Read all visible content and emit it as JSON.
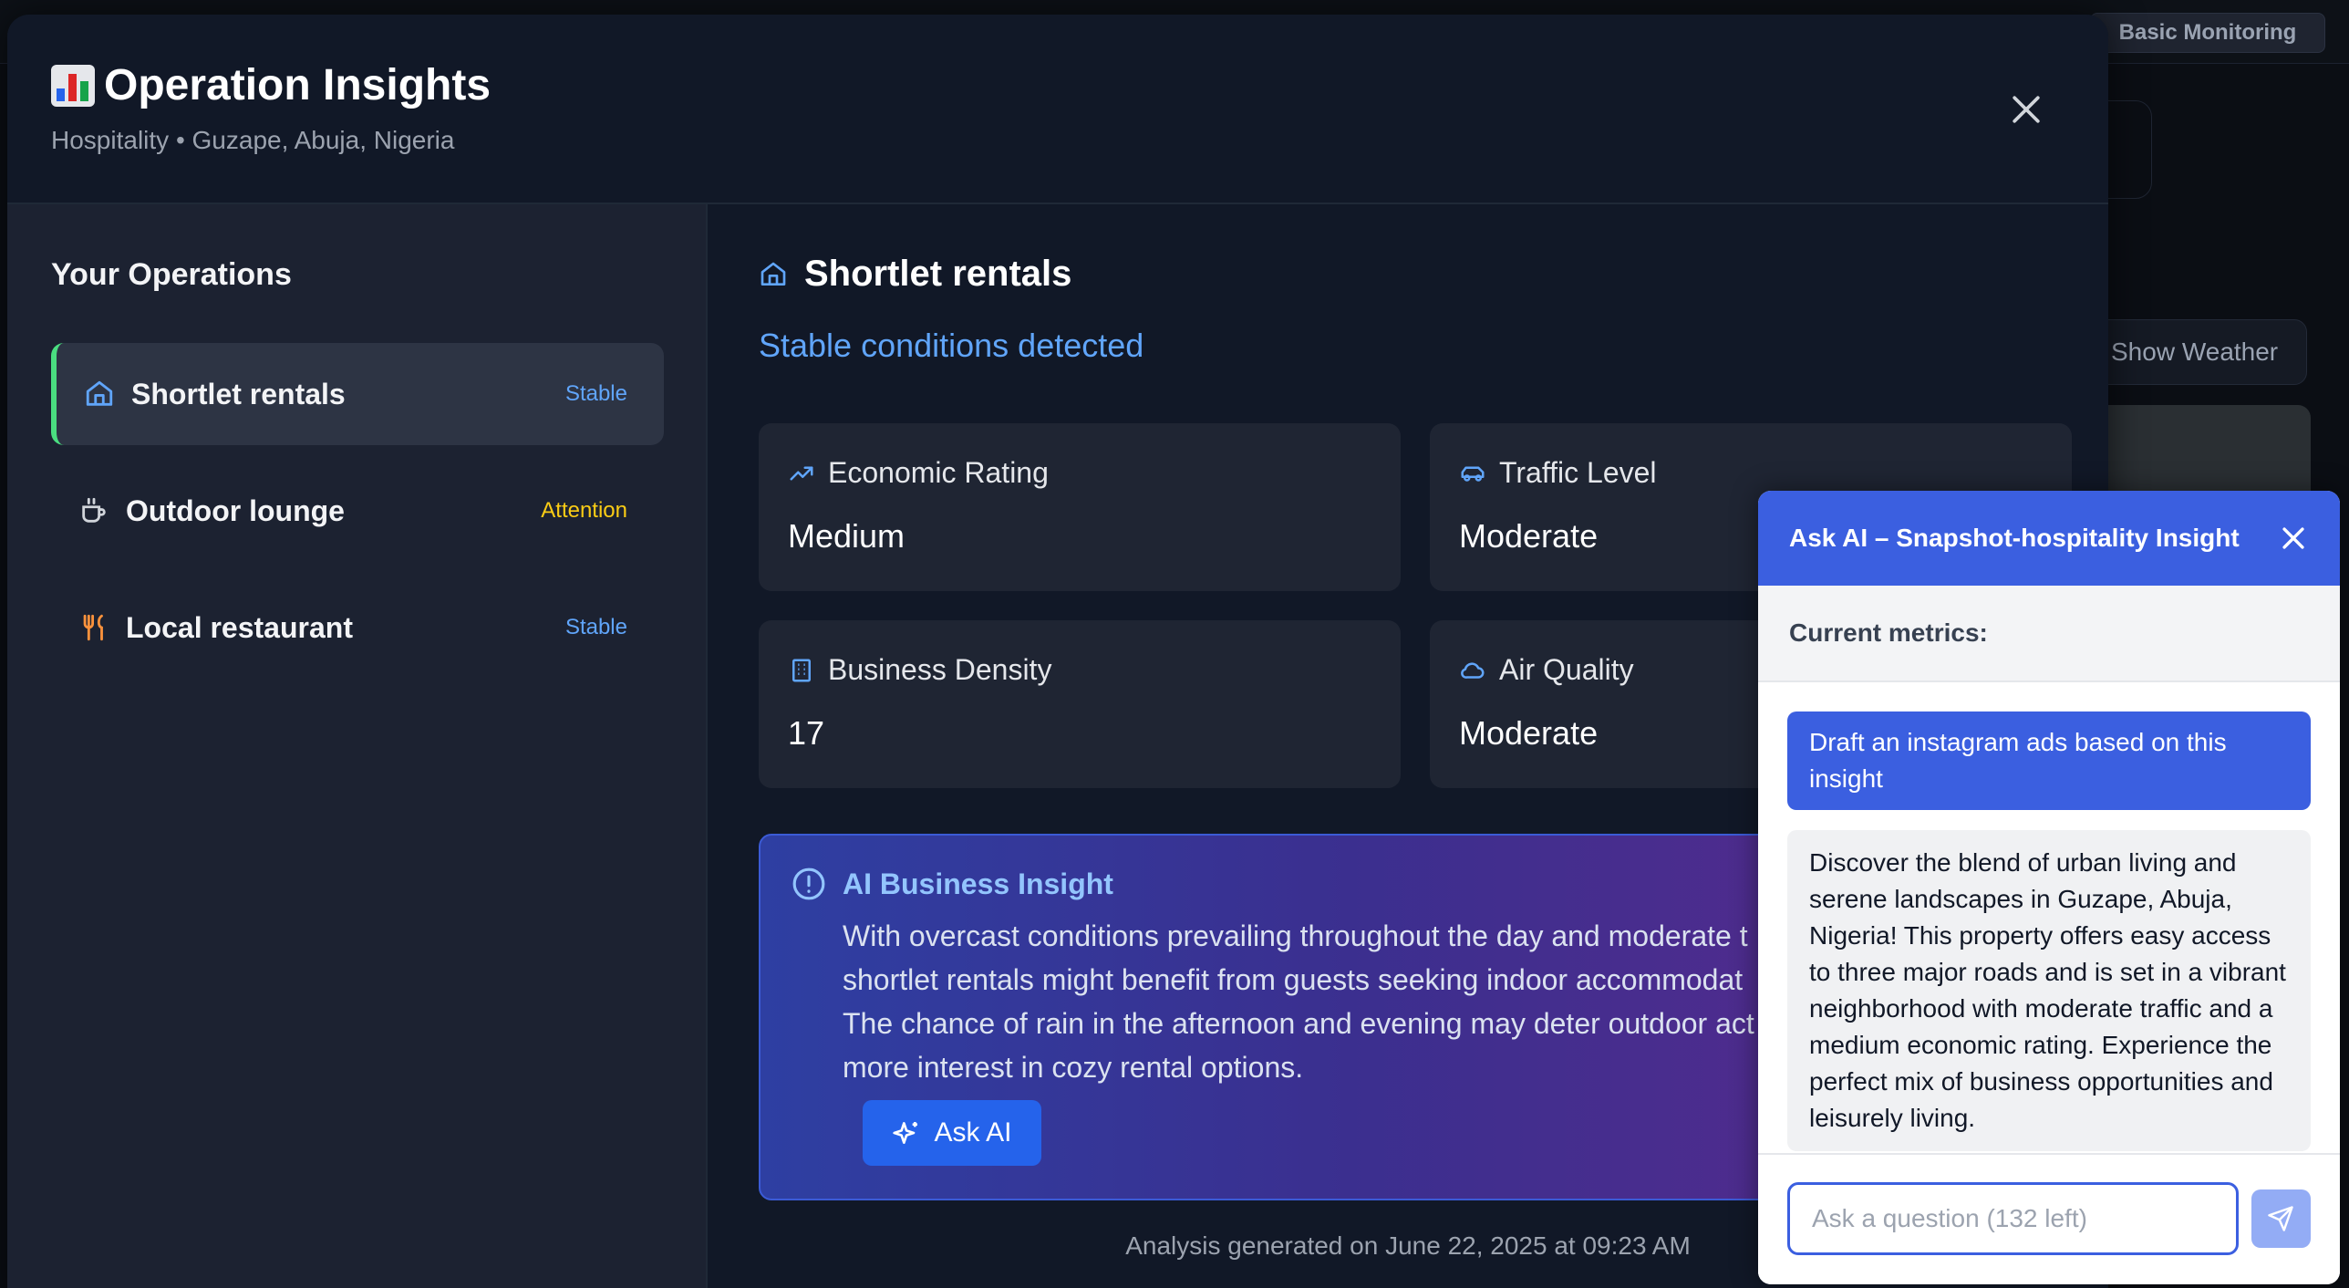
{
  "background": {
    "pill_label": "Basic Monitoring",
    "weather_button": "Show Weather"
  },
  "modal": {
    "title": "Operation Insights",
    "title_icon": "bar-chart-emoji",
    "subtitle": "Hospitality • Guzape, Abuja, Nigeria"
  },
  "sidebar": {
    "heading": "Your Operations",
    "items": [
      {
        "label": "Shortlet rentals",
        "status": "Stable",
        "icon": "home-icon"
      },
      {
        "label": "Outdoor lounge",
        "status": "Attention",
        "icon": "coffee-icon"
      },
      {
        "label": "Local restaurant",
        "status": "Stable",
        "icon": "utensils-icon"
      }
    ]
  },
  "main": {
    "title": "Shortlet rentals",
    "status_text": "Stable conditions detected",
    "metrics": [
      {
        "label": "Economic Rating",
        "value": "Medium",
        "icon": "trending-up-icon"
      },
      {
        "label": "Traffic Level",
        "value": "Moderate",
        "icon": "car-icon"
      },
      {
        "label": "Business Density",
        "value": "17",
        "icon": "building-icon"
      },
      {
        "label": "Air Quality",
        "value": "Moderate",
        "icon": "cloud-icon"
      }
    ],
    "insight": {
      "heading": "AI Business Insight",
      "lines": [
        "With overcast conditions prevailing throughout the day and moderate t",
        "shortlet rentals might benefit from guests seeking indoor accommodat",
        "The chance of rain in the afternoon and evening may deter outdoor act",
        "more interest in cozy rental options."
      ],
      "button": "Ask AI"
    },
    "footer": "Analysis generated on June 22, 2025 at 09:23 AM"
  },
  "chat": {
    "title": "Ask AI – Snapshot-hospitality Insight",
    "metrics_label": "Current metrics:",
    "user_message": "Draft an instagram ads based on this insight",
    "ai_message": "Discover the blend of urban living and serene landscapes in Guzape, Abuja, Nigeria! This property offers easy access to three major roads and is set in a vibrant neighborhood with moderate traffic and a medium economic rating. Experience the perfect mix of business opportunities and leisurely living.",
    "input_placeholder": "Ask a question (132 left)"
  },
  "colors": {
    "accent_blue": "#3b5fe0",
    "stable": "#60a5fa",
    "attention": "#facc15",
    "active_bar": "#4ade80"
  }
}
